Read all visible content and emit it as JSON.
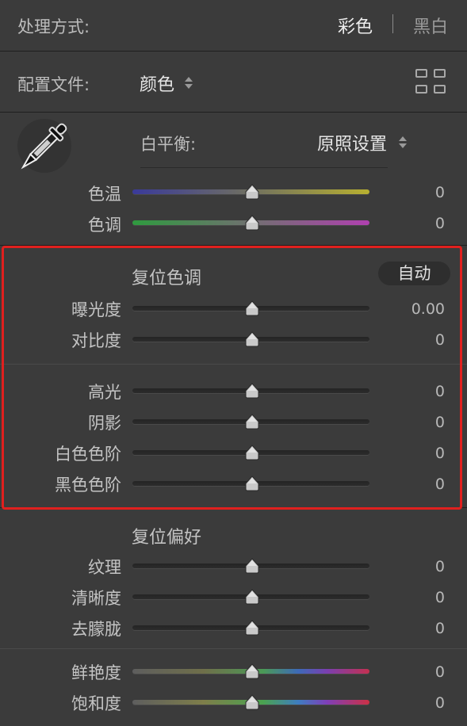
{
  "treatment": {
    "label": "处理方式:",
    "color": "彩色",
    "bw": "黑白"
  },
  "profile": {
    "label": "配置文件:",
    "value": "颜色",
    "grid_icon": "grid-view-icon"
  },
  "white_balance": {
    "label": "白平衡:",
    "value": "原照设置",
    "tool_icon": "eyedropper-icon"
  },
  "wb_sliders": [
    {
      "label": "色温",
      "value": "0",
      "level": 0.5
    },
    {
      "label": "色调",
      "value": "0",
      "level": 0.5
    }
  ],
  "tone": {
    "title": "复位色调",
    "auto_label": "自动",
    "sliders": [
      {
        "label": "曝光度",
        "value": "0.00",
        "level": 0.5
      },
      {
        "label": "对比度",
        "value": "0",
        "level": 0.5
      },
      {
        "label": "高光",
        "value": "0",
        "level": 0.5
      },
      {
        "label": "阴影",
        "value": "0",
        "level": 0.5
      },
      {
        "label": "白色色阶",
        "value": "0",
        "level": 0.5
      },
      {
        "label": "黑色色阶",
        "value": "0",
        "level": 0.5
      }
    ]
  },
  "presence": {
    "title": "复位偏好",
    "sliders": [
      {
        "label": "纹理",
        "value": "0",
        "level": 0.5
      },
      {
        "label": "清晰度",
        "value": "0",
        "level": 0.5
      },
      {
        "label": "去朦胧",
        "value": "0",
        "level": 0.5
      },
      {
        "label": "鲜艳度",
        "value": "0",
        "level": 0.5
      },
      {
        "label": "饱和度",
        "value": "0",
        "level": 0.5
      }
    ]
  },
  "colors": {
    "highlight_box": "#e0201e",
    "panel_bg": "#3b3b3b"
  }
}
